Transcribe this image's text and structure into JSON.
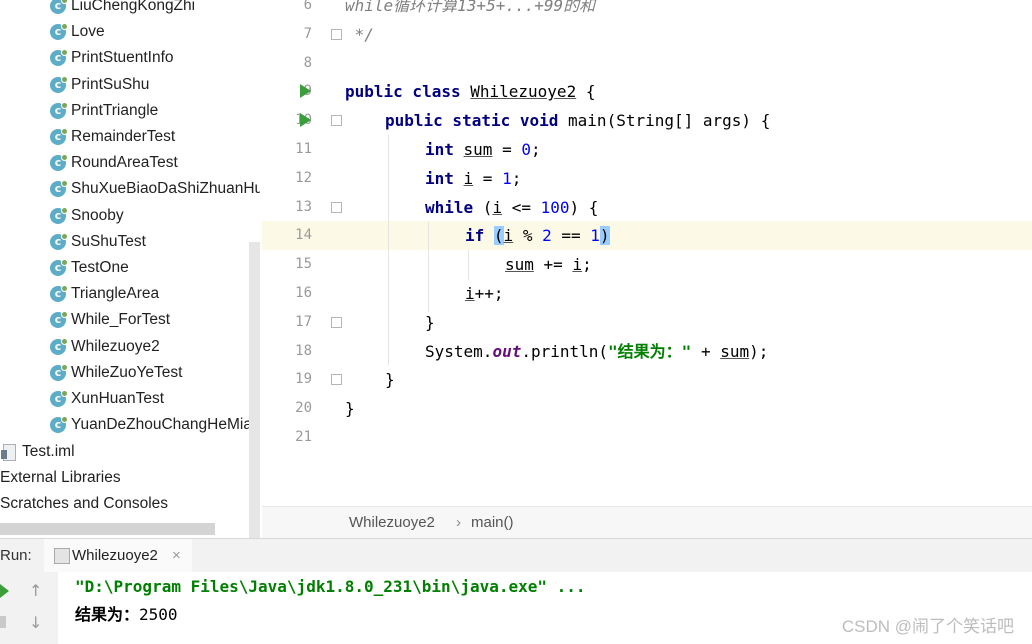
{
  "project_tree": {
    "classes": [
      "LiuChengKongZhi",
      "Love",
      "PrintStuentInfo",
      "PrintSuShu",
      "PrintTriangle",
      "RemainderTest",
      "RoundAreaTest",
      "ShuXueBiaoDaShiZhuanHu",
      "Snooby",
      "SuShuTest",
      "TestOne",
      "TriangleArea",
      "While_ForTest",
      "Whilezuoye2",
      "WhileZuoYeTest",
      "XunHuanTest",
      "YuanDeZhouChangHeMian"
    ],
    "iml_file": "Test.iml",
    "external_libraries": "External Libraries",
    "scratches": "Scratches and Consoles"
  },
  "editor": {
    "line_numbers": [
      "6",
      "7",
      "8",
      "9",
      "10",
      "11",
      "12",
      "13",
      "14",
      "15",
      "16",
      "17",
      "18",
      "19",
      "20",
      "21"
    ],
    "lines": {
      "l6": "while循环计算13+5+...+99的和",
      "l7": " */",
      "l9_kw": "public class ",
      "l9_name": "Whilezuoye2",
      "l9_rest": " {",
      "l10_kw": "public static void ",
      "l10_rest": "main(String[] args) {",
      "l11_kw": "int ",
      "l11_var": "sum",
      "l11_mid": " = ",
      "l11_num": "0",
      "l11_end": ";",
      "l12_kw": "int ",
      "l12_var": "i",
      "l12_mid": " = ",
      "l12_num": "1",
      "l12_end": ";",
      "l13_kw": "while ",
      "l13_open": "(",
      "l13_var": "i",
      "l13_mid": " <= ",
      "l13_num": "100",
      "l13_end": ") {",
      "l14_kw": "if ",
      "l14_open": "(",
      "l14_var": "i",
      "l14_mid": " % ",
      "l14_num1": "2",
      "l14_mid2": " == ",
      "l14_num2": "1",
      "l14_close": ")",
      "l15_var": "sum",
      "l15_mid": " += ",
      "l15_var2": "i",
      "l15_end": ";",
      "l16_var": "i",
      "l16_end": "++;",
      "l17": "}",
      "l18_a": "System.",
      "l18_out": "out",
      "l18_b": ".println(",
      "l18_str": "\"结果为：\"",
      "l18_c": " + ",
      "l18_var": "sum",
      "l18_d": ");",
      "l19": "}",
      "l20": "}"
    }
  },
  "breadcrumb": {
    "class_name": "Whilezuoye2",
    "separator": "›",
    "method": "main()"
  },
  "run_panel": {
    "label": "Run:",
    "tab_label": "Whilezuoye2",
    "close": "×",
    "command": "\"D:\\Program Files\\Java\\jdk1.8.0_231\\bin\\java.exe\" ...",
    "output_label": "结果为：",
    "output_value": "2500"
  },
  "watermark": "CSDN @闹了个笑话吧",
  "colors": {
    "keyword": "#000080",
    "number": "#0000ff",
    "string": "#008000",
    "run_green": "#3a9e3a",
    "current_line": "#fcfae6"
  }
}
